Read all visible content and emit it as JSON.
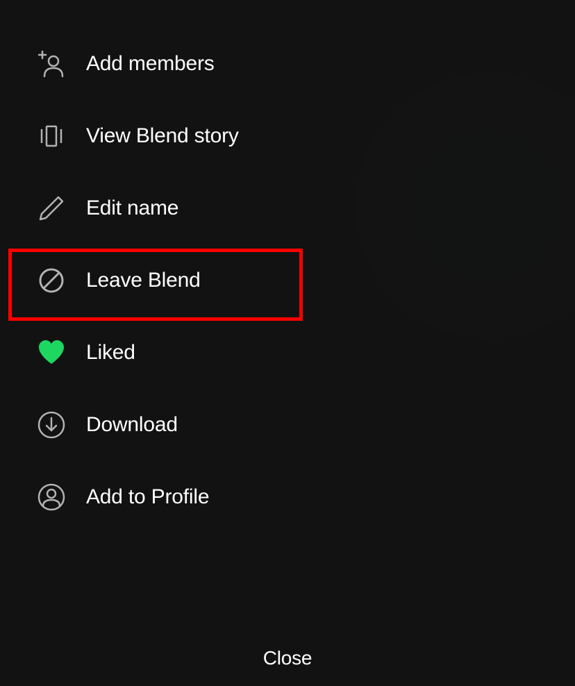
{
  "menu": {
    "items": [
      {
        "label": "Add members"
      },
      {
        "label": "View Blend story"
      },
      {
        "label": "Edit name"
      },
      {
        "label": "Leave Blend"
      },
      {
        "label": "Liked"
      },
      {
        "label": "Download"
      },
      {
        "label": "Add to Profile"
      }
    ],
    "close_label": "Close"
  },
  "colors": {
    "accent_green": "#1ed760",
    "icon_gray": "#a7a7a7",
    "highlight_red": "#ff0000"
  }
}
